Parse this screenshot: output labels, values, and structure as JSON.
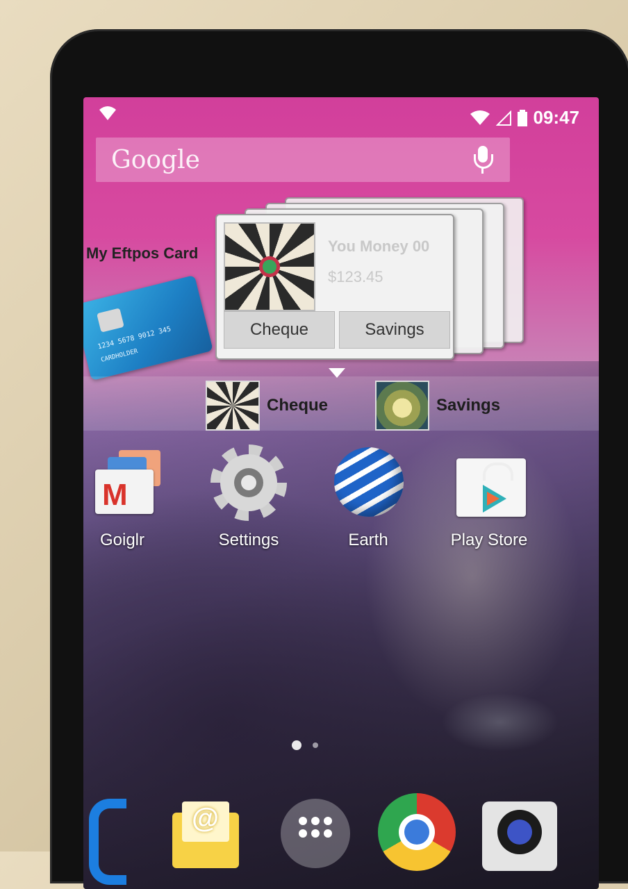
{
  "status_bar": {
    "time": "09:47",
    "notification_icon": "wifi-alert-icon",
    "wifi_icon": "wifi-icon",
    "signal_icon": "signal-icon",
    "battery_icon": "battery-icon"
  },
  "search": {
    "logo": "Google",
    "mic_icon": "mic-icon"
  },
  "widget": {
    "title": "My Eftpos Card",
    "card_number": "1234 5678 9012 345",
    "card_holder": "CARDHOLDER",
    "card_title": "You Money 00",
    "card_amount": "$123.45",
    "buttons": [
      "Cheque",
      "Savings"
    ],
    "shortcuts": [
      "Cheque",
      "Savings"
    ]
  },
  "apps": [
    {
      "label": "Goiglr",
      "icon": "gmail-icon"
    },
    {
      "label": "Settings",
      "icon": "settings-gear-icon"
    },
    {
      "label": "Earth",
      "icon": "earth-globe-icon"
    },
    {
      "label": "Play Store",
      "icon": "play-store-icon"
    }
  ],
  "dock": [
    {
      "name": "phone-icon"
    },
    {
      "name": "email-icon"
    },
    {
      "name": "app-drawer-icon"
    },
    {
      "name": "chrome-icon"
    },
    {
      "name": "camera-icon"
    }
  ],
  "colors": {
    "wallpaper_top": "#d23f9b",
    "chrome_red": "#db3a2e",
    "chrome_yellow": "#f7c431",
    "chrome_green": "#2fa64f",
    "phone_blue": "#1c7ee0"
  }
}
